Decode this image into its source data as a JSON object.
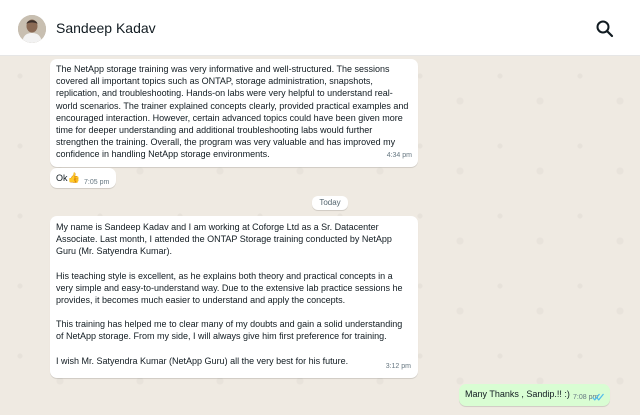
{
  "header": {
    "contact_name": "Sandeep Kadav",
    "avatar_icon": "person-avatar",
    "search_icon": "search-icon"
  },
  "messages": [
    {
      "direction": "incoming",
      "text": "The NetApp storage training was very informative and well-structured. The sessions covered all important topics such as ONTAP, storage administration, snapshots, replication, and troubleshooting. Hands-on labs were very helpful to understand real-world scenarios. The trainer explained concepts clearly, provided practical examples and encouraged interaction. However, certain advanced topics could have been given more time for deeper understanding and additional troubleshooting labs would further strengthen the training. Overall, the program was very valuable and has improved my confidence in handling NetApp storage environments.",
      "time": "4:34 pm"
    },
    {
      "direction": "incoming",
      "text": "Ok",
      "emoji": "👍",
      "time": "7:05 pm"
    }
  ],
  "day_separator": "Today",
  "today_messages": [
    {
      "direction": "incoming",
      "paragraphs": [
        "My name is Sandeep Kadav and I am working at Coforge Ltd as a Sr. Datacenter Associate. Last month, I attended the ONTAP Storage training conducted by NetApp Guru (Mr. Satyendra Kumar).",
        "His teaching style is excellent, as he explains both theory and practical concepts in a very simple and easy-to-understand way. Due to the extensive lab practice sessions he provides, it becomes much easier to understand and apply the concepts.",
        "This training has helped me to clear many of my doubts and gain a solid understanding of NetApp storage. From my side, I will always give him first preference for training.",
        "I wish Mr. Satyendra Kumar (NetApp Guru) all the very best for his future."
      ],
      "time": "3:12 pm"
    },
    {
      "direction": "outgoing",
      "text": "Many Thanks , Sandip.!! :)",
      "time": "7:08 pm",
      "status": "read",
      "status_icon": "double-check-icon",
      "status_color": "#53bdeb"
    }
  ],
  "colors": {
    "chat_background": "#efeae2",
    "incoming_bubble": "#ffffff",
    "outgoing_bubble": "#d9fdd3"
  }
}
